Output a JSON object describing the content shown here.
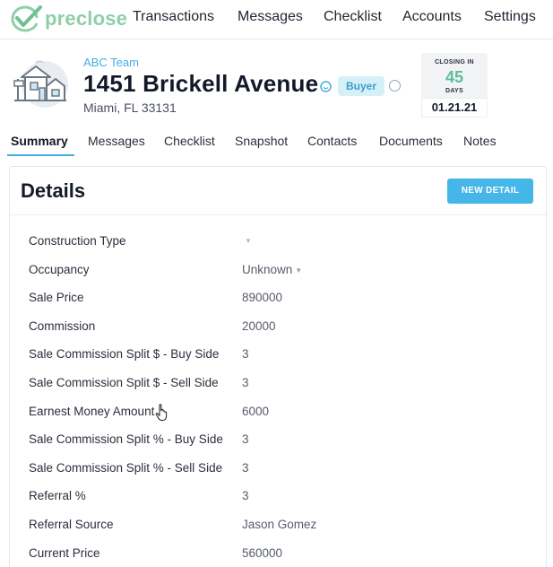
{
  "brand": {
    "name": "preclose",
    "color": "#8fcfa8"
  },
  "nav": {
    "items": [
      {
        "key": "transactions",
        "label": "Transactions"
      },
      {
        "key": "messages",
        "label": "Messages"
      },
      {
        "key": "checklist",
        "label": "Checklist"
      },
      {
        "key": "accounts",
        "label": "Accounts"
      },
      {
        "key": "settings",
        "label": "Settings"
      }
    ]
  },
  "property": {
    "team": "ABC Team",
    "address": "1451 Brickell Avenue",
    "badge": "Buyer",
    "city": "Miami, FL 33131"
  },
  "closing": {
    "label": "CLOSING IN",
    "days": "45",
    "unit": "DAYS",
    "date": "01.21.21"
  },
  "tabs": [
    {
      "key": "summary",
      "label": "Summary",
      "active": true
    },
    {
      "key": "messages",
      "label": "Messages"
    },
    {
      "key": "checklist",
      "label": "Checklist"
    },
    {
      "key": "snapshot",
      "label": "Snapshot"
    },
    {
      "key": "contacts",
      "label": "Contacts"
    },
    {
      "key": "documents",
      "label": "Documents"
    },
    {
      "key": "notes",
      "label": "Notes"
    }
  ],
  "details": {
    "title": "Details",
    "new_button": "NEW DETAIL",
    "rows": [
      {
        "label": "Construction Type",
        "value": ""
      },
      {
        "label": "Occupancy",
        "value": "Unknown"
      },
      {
        "label": "Sale Price",
        "value": "890000"
      },
      {
        "label": "Commission",
        "value": "20000"
      },
      {
        "label": "Sale Commission Split $ - Buy Side",
        "value": "3"
      },
      {
        "label": "Sale Commission Split $ - Sell Side",
        "value": "3"
      },
      {
        "label": "Earnest Money Amount",
        "value": "6000"
      },
      {
        "label": "Sale Commission Split % - Buy Side",
        "value": "3"
      },
      {
        "label": "Sale Commission Split % - Sell Side",
        "value": "3"
      },
      {
        "label": "Referral %",
        "value": "3"
      },
      {
        "label": "Referral Source",
        "value": "Jason Gomez"
      },
      {
        "label": "Current Price",
        "value": "560000"
      }
    ]
  },
  "colors": {
    "accent": "#45aee0",
    "button": "#45b6e8",
    "closing_days": "#5bbf9a"
  },
  "icons": [
    "logo-check-icon",
    "house-icon",
    "smile-icon",
    "radio-icon",
    "dropdown-caret-icon",
    "hand-pointer-icon"
  ]
}
